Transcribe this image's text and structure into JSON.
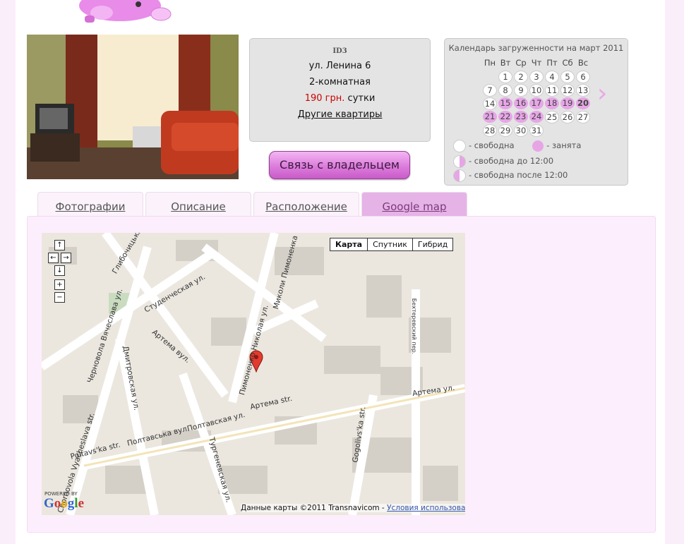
{
  "listing": {
    "id": "ID3",
    "address": "ул. Ленина 6",
    "rooms": "2-комнатная",
    "price": "190 грн.",
    "price_unit": "сутки",
    "other_link": "Другие квартиры"
  },
  "contact_button": "Связь с владельцем",
  "calendar": {
    "title": "Календарь загруженности на март 2011",
    "weekdays": [
      "Пн",
      "Вт",
      "Ср",
      "Чт",
      "Пт",
      "Сб",
      "Вс"
    ],
    "legend": {
      "free": "- свободна",
      "busy": "- занята",
      "free_until": "- свободна до 12:00",
      "free_after": "- свободна после 12:00"
    }
  },
  "tabs": [
    "Фотографии",
    "Описание",
    "Расположение",
    "Google map"
  ],
  "map": {
    "type_buttons": [
      "Карта",
      "Спутник",
      "Гибрид"
    ],
    "powered_by": "POWERED BY",
    "logo": "Google",
    "attribution": "Данные карты ©2011 Transnavicom -",
    "terms_link": "Условия использования",
    "streets": [
      "Студенческая ул.",
      "Артема вул.",
      "Артема str.",
      "Артема ул.",
      "Полтавская ул.",
      "Полтавськa вул.",
      "Poltavs'ka str.",
      "Дмитровская ул.",
      "Тургеневская ул.",
      "Пимоненко Николая ул.",
      "Миколи Пимоненка",
      "Глибочицька",
      "Черновола Вячеслава ул.",
      "Chornovola Vyacheslava str.",
      "Gogolivs'ka str.",
      "Бехтеревский пер."
    ]
  },
  "colors": {
    "accent": "#e6b3e6",
    "busy": "#e6a6e6",
    "price": "#cc0000",
    "page_bg": "#fbeefb"
  }
}
